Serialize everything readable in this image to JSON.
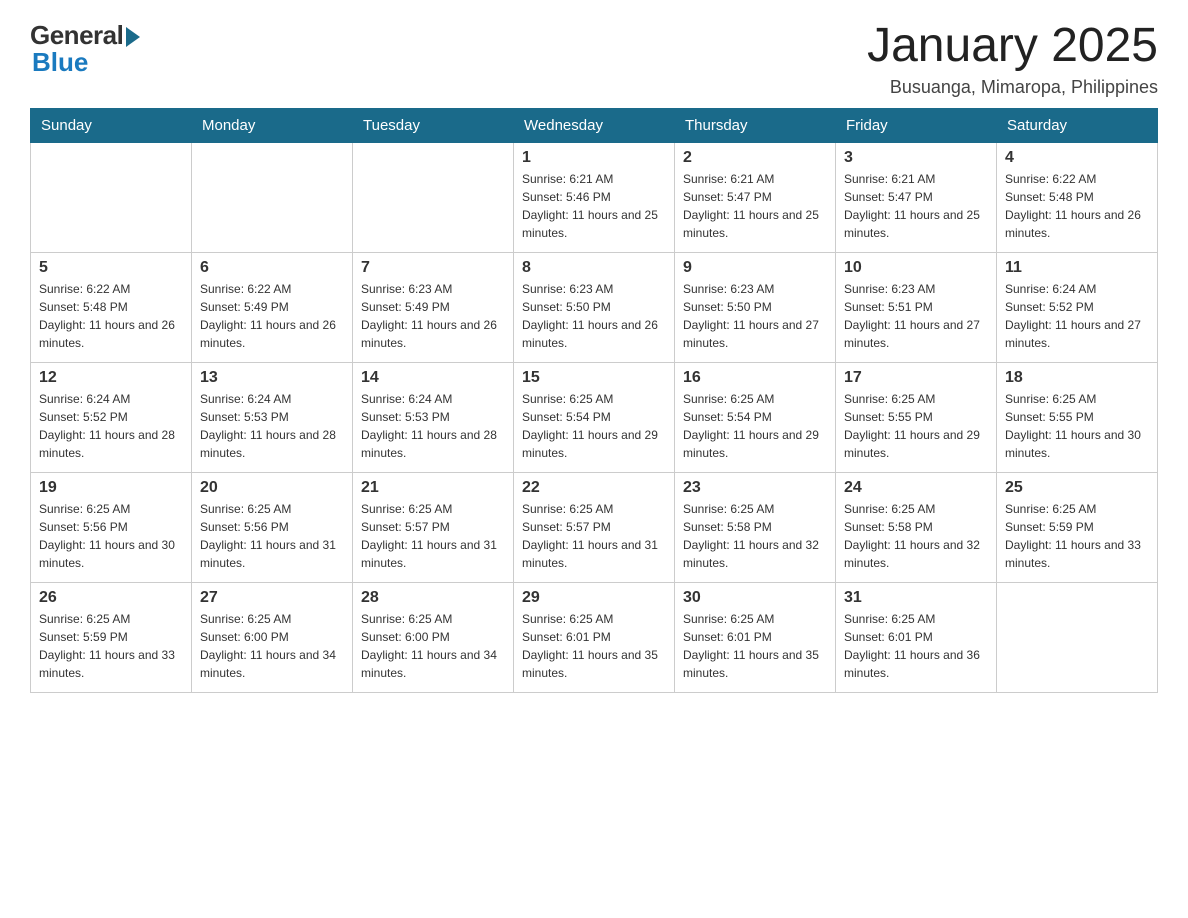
{
  "header": {
    "logo": {
      "general": "General",
      "blue": "Blue"
    },
    "title": "January 2025",
    "location": "Busuanga, Mimaropa, Philippines"
  },
  "days_of_week": [
    "Sunday",
    "Monday",
    "Tuesday",
    "Wednesday",
    "Thursday",
    "Friday",
    "Saturday"
  ],
  "weeks": [
    [
      {
        "day": "",
        "info": ""
      },
      {
        "day": "",
        "info": ""
      },
      {
        "day": "",
        "info": ""
      },
      {
        "day": "1",
        "info": "Sunrise: 6:21 AM\nSunset: 5:46 PM\nDaylight: 11 hours and 25 minutes."
      },
      {
        "day": "2",
        "info": "Sunrise: 6:21 AM\nSunset: 5:47 PM\nDaylight: 11 hours and 25 minutes."
      },
      {
        "day": "3",
        "info": "Sunrise: 6:21 AM\nSunset: 5:47 PM\nDaylight: 11 hours and 25 minutes."
      },
      {
        "day": "4",
        "info": "Sunrise: 6:22 AM\nSunset: 5:48 PM\nDaylight: 11 hours and 26 minutes."
      }
    ],
    [
      {
        "day": "5",
        "info": "Sunrise: 6:22 AM\nSunset: 5:48 PM\nDaylight: 11 hours and 26 minutes."
      },
      {
        "day": "6",
        "info": "Sunrise: 6:22 AM\nSunset: 5:49 PM\nDaylight: 11 hours and 26 minutes."
      },
      {
        "day": "7",
        "info": "Sunrise: 6:23 AM\nSunset: 5:49 PM\nDaylight: 11 hours and 26 minutes."
      },
      {
        "day": "8",
        "info": "Sunrise: 6:23 AM\nSunset: 5:50 PM\nDaylight: 11 hours and 26 minutes."
      },
      {
        "day": "9",
        "info": "Sunrise: 6:23 AM\nSunset: 5:50 PM\nDaylight: 11 hours and 27 minutes."
      },
      {
        "day": "10",
        "info": "Sunrise: 6:23 AM\nSunset: 5:51 PM\nDaylight: 11 hours and 27 minutes."
      },
      {
        "day": "11",
        "info": "Sunrise: 6:24 AM\nSunset: 5:52 PM\nDaylight: 11 hours and 27 minutes."
      }
    ],
    [
      {
        "day": "12",
        "info": "Sunrise: 6:24 AM\nSunset: 5:52 PM\nDaylight: 11 hours and 28 minutes."
      },
      {
        "day": "13",
        "info": "Sunrise: 6:24 AM\nSunset: 5:53 PM\nDaylight: 11 hours and 28 minutes."
      },
      {
        "day": "14",
        "info": "Sunrise: 6:24 AM\nSunset: 5:53 PM\nDaylight: 11 hours and 28 minutes."
      },
      {
        "day": "15",
        "info": "Sunrise: 6:25 AM\nSunset: 5:54 PM\nDaylight: 11 hours and 29 minutes."
      },
      {
        "day": "16",
        "info": "Sunrise: 6:25 AM\nSunset: 5:54 PM\nDaylight: 11 hours and 29 minutes."
      },
      {
        "day": "17",
        "info": "Sunrise: 6:25 AM\nSunset: 5:55 PM\nDaylight: 11 hours and 29 minutes."
      },
      {
        "day": "18",
        "info": "Sunrise: 6:25 AM\nSunset: 5:55 PM\nDaylight: 11 hours and 30 minutes."
      }
    ],
    [
      {
        "day": "19",
        "info": "Sunrise: 6:25 AM\nSunset: 5:56 PM\nDaylight: 11 hours and 30 minutes."
      },
      {
        "day": "20",
        "info": "Sunrise: 6:25 AM\nSunset: 5:56 PM\nDaylight: 11 hours and 31 minutes."
      },
      {
        "day": "21",
        "info": "Sunrise: 6:25 AM\nSunset: 5:57 PM\nDaylight: 11 hours and 31 minutes."
      },
      {
        "day": "22",
        "info": "Sunrise: 6:25 AM\nSunset: 5:57 PM\nDaylight: 11 hours and 31 minutes."
      },
      {
        "day": "23",
        "info": "Sunrise: 6:25 AM\nSunset: 5:58 PM\nDaylight: 11 hours and 32 minutes."
      },
      {
        "day": "24",
        "info": "Sunrise: 6:25 AM\nSunset: 5:58 PM\nDaylight: 11 hours and 32 minutes."
      },
      {
        "day": "25",
        "info": "Sunrise: 6:25 AM\nSunset: 5:59 PM\nDaylight: 11 hours and 33 minutes."
      }
    ],
    [
      {
        "day": "26",
        "info": "Sunrise: 6:25 AM\nSunset: 5:59 PM\nDaylight: 11 hours and 33 minutes."
      },
      {
        "day": "27",
        "info": "Sunrise: 6:25 AM\nSunset: 6:00 PM\nDaylight: 11 hours and 34 minutes."
      },
      {
        "day": "28",
        "info": "Sunrise: 6:25 AM\nSunset: 6:00 PM\nDaylight: 11 hours and 34 minutes."
      },
      {
        "day": "29",
        "info": "Sunrise: 6:25 AM\nSunset: 6:01 PM\nDaylight: 11 hours and 35 minutes."
      },
      {
        "day": "30",
        "info": "Sunrise: 6:25 AM\nSunset: 6:01 PM\nDaylight: 11 hours and 35 minutes."
      },
      {
        "day": "31",
        "info": "Sunrise: 6:25 AM\nSunset: 6:01 PM\nDaylight: 11 hours and 36 minutes."
      },
      {
        "day": "",
        "info": ""
      }
    ]
  ]
}
